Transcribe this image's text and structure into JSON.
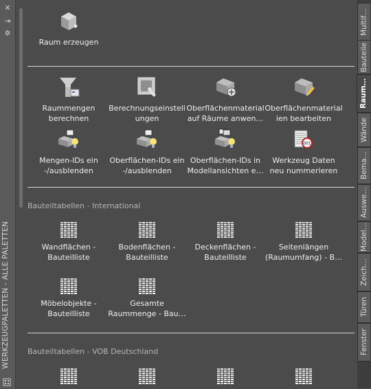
{
  "window": {
    "title": "WERKZEUGPALETTEN - ALLE PALETTEN",
    "icons": [
      "close-icon",
      "auto-hide-icon",
      "properties-icon",
      "palette-menu-icon"
    ]
  },
  "tools_top": [
    {
      "label": "Raum erzeugen",
      "icon": "create-space-icon"
    }
  ],
  "tools_space": [
    {
      "label": "Raummengen\nberechnen",
      "icon": "calculate-quantities-icon"
    },
    {
      "label": "Berechnungseinstell\nungen",
      "icon": "calculation-settings-icon"
    },
    {
      "label": "Oberflächenmaterial\nauf Räume anwen…",
      "icon": "apply-surface-material-icon"
    },
    {
      "label": "Oberflächenmaterial\nien bearbeiten",
      "icon": "edit-surface-material-icon"
    },
    {
      "label": "Mengen-IDs ein\n-/ausblenden",
      "icon": "quantity-ids-toggle-icon"
    },
    {
      "label": "Oberflächen-IDs ein\n-/ausblenden",
      "icon": "surface-ids-toggle-icon"
    },
    {
      "label": "Oberflächen-IDs in\nModellansichten  e…",
      "icon": "surface-ids-model-icon"
    },
    {
      "label": "Werkzeug Daten\nneu nummerieren",
      "icon": "renumber-data-icon"
    }
  ],
  "section_international": {
    "title": "Bauteiltabellen - International",
    "tools": [
      {
        "label": "Wandflächen -\nBauteilliste",
        "icon": "schedule-table-icon"
      },
      {
        "label": "Bodenflächen -\nBauteilliste",
        "icon": "schedule-table-icon"
      },
      {
        "label": "Deckenflächen -\nBauteilliste",
        "icon": "schedule-table-icon"
      },
      {
        "label": "Seitenlängen\n(Raumumfang) -  B…",
        "icon": "schedule-table-icon"
      },
      {
        "label": "Möbelobjekte -\nBauteilliste",
        "icon": "schedule-table-icon"
      },
      {
        "label": "Gesamte\nRaummenge -  Bau…",
        "icon": "schedule-table-icon"
      }
    ]
  },
  "section_vob": {
    "title": "Bauteiltabellen - VOB Deutschland"
  },
  "tabs": [
    {
      "label": "Multif…",
      "active": false
    },
    {
      "label": "Bauteile",
      "active": false
    },
    {
      "label": "Raum…",
      "active": true
    },
    {
      "label": "Wände",
      "active": false
    },
    {
      "label": "Bema…",
      "active": false
    },
    {
      "label": "Auswe…",
      "active": false
    },
    {
      "label": "Model…",
      "active": false
    },
    {
      "label": "Zeich…",
      "active": false
    },
    {
      "label": "Türen",
      "active": false
    },
    {
      "label": "Fenster",
      "active": false
    }
  ],
  "colors": {
    "background": "#4b4b4b",
    "separator": "#d8d8d8",
    "section_title": "#b6b6b6"
  }
}
